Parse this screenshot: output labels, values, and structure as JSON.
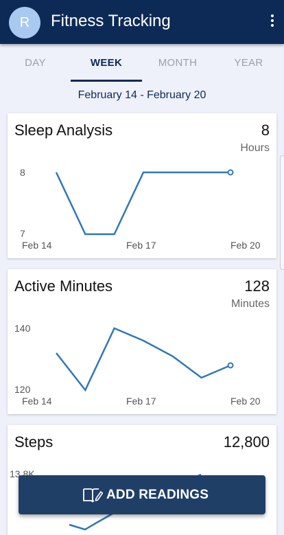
{
  "app": {
    "title": "Fitness Tracking",
    "avatar_initial": "R"
  },
  "tabs": [
    {
      "label": "DAY",
      "active": false
    },
    {
      "label": "WEEK",
      "active": true
    },
    {
      "label": "MONTH",
      "active": false
    },
    {
      "label": "YEAR",
      "active": false
    }
  ],
  "date_range": "February 14 - February 20",
  "cards": [
    {
      "title": "Sleep Analysis",
      "value": "8",
      "unit": "Hours"
    },
    {
      "title": "Active Minutes",
      "value": "128",
      "unit": "Minutes"
    },
    {
      "title": "Steps",
      "value": "12,800",
      "unit": ""
    }
  ],
  "chart_data": [
    {
      "type": "line",
      "title": "Sleep Analysis",
      "x": [
        "Feb 14",
        "Feb 15",
        "Feb 16",
        "Feb 17",
        "Feb 18",
        "Feb 19",
        "Feb 20"
      ],
      "x_tick_labels": [
        "Feb 14",
        "Feb 17",
        "Feb 20"
      ],
      "y_tick_labels": [
        "8",
        "7"
      ],
      "ylim": [
        7,
        8
      ],
      "series": [
        {
          "values": [
            8,
            7,
            7,
            8,
            8,
            8,
            8
          ]
        }
      ],
      "grid": false,
      "color": "#2e78b7"
    },
    {
      "type": "line",
      "title": "Active Minutes",
      "x": [
        "Feb 14",
        "Feb 15",
        "Feb 16",
        "Feb 17",
        "Feb 18",
        "Feb 19",
        "Feb 20"
      ],
      "x_tick_labels": [
        "Feb 14",
        "Feb 17",
        "Feb 20"
      ],
      "y_tick_labels": [
        "140",
        "120"
      ],
      "ylim": [
        120,
        140
      ],
      "series": [
        {
          "values": [
            132,
            120,
            140,
            136,
            131,
            124,
            128
          ]
        }
      ],
      "grid": false,
      "color": "#2e78b7"
    },
    {
      "type": "line",
      "title": "Steps",
      "y_tick_labels": [
        "13.8K"
      ],
      "partially_hidden": true
    }
  ],
  "fab": {
    "label": "ADD READINGS",
    "icon": "book-edit-icon"
  },
  "colors": {
    "primary": "#0d2a57",
    "line": "#2e78b7",
    "fab": "#1f3f67",
    "background": "#eef1fa"
  }
}
